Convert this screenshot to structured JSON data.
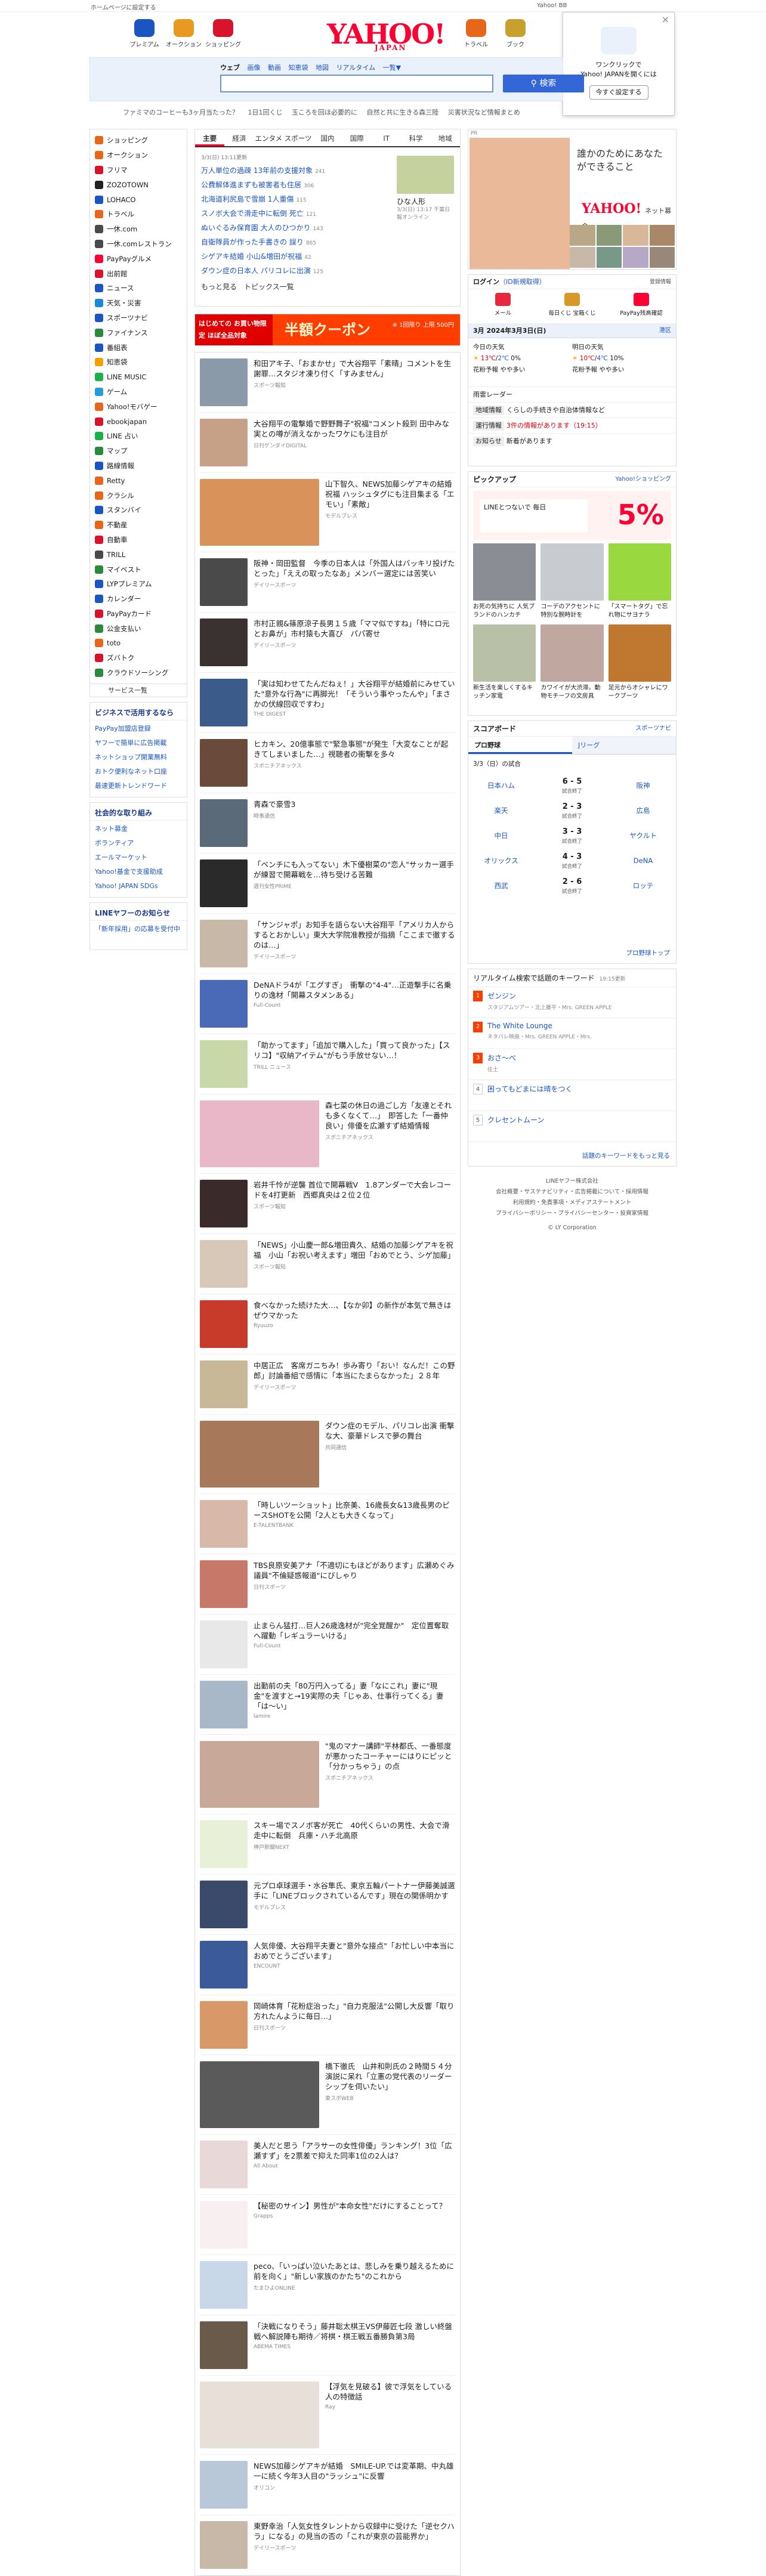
{
  "topbar": {
    "home": "ホームページに設定する",
    "right": "Yahoo! BB"
  },
  "header": {
    "logo": "YAHOO!",
    "logo_sub": "JAPAN",
    "services": [
      "プレミアム",
      "オークション",
      "ショッピング",
      "トラベル",
      "ブック"
    ]
  },
  "popup": {
    "line1": "ワンクリックで",
    "line2": "Yahoo! JAPANを開くには",
    "button": "今すぐ設定する",
    "close": "×"
  },
  "search": {
    "tabs": [
      "ウェブ",
      "画像",
      "動画",
      "知恵袋",
      "地図",
      "リアルタイム",
      "一覧▼"
    ],
    "placeholder": "",
    "button": "検索"
  },
  "notices": [
    "ファミマのコーヒーも3ヶ月当たった？",
    "1日1回くじ",
    "玉ころを回ほ必要的に",
    "自然と共に生きる森三陸",
    "災害状況など情報まとめ"
  ],
  "leftnav": {
    "items": [
      "ショッピング",
      "オークション",
      "フリマ",
      "ZOZOTOWN",
      "LOHACO",
      "トラベル",
      "一休.com",
      "一休.comレストラン",
      "PayPayグルメ",
      "出前館",
      "ニュース",
      "天気・災害",
      "スポーツナビ",
      "ファイナンス",
      "番組表",
      "知恵袋",
      "LINE MUSIC",
      "ゲーム",
      "Yahoo!モバゲー",
      "ebookjapan",
      "LINE 占い",
      "マップ",
      "路線情報",
      "Retty",
      "クラシル",
      "スタンバイ",
      "不動産",
      "自動車",
      "TRILL",
      "マイベスト",
      "LYPプレミアム",
      "カレンダー",
      "PayPayカード",
      "公金支払い",
      "toto",
      "ズバトク",
      "クラウドソーシング"
    ],
    "all": "サービス一覧",
    "biz_title": "ビジネスで活用するなら",
    "biz": [
      "PayPay加盟店登録",
      "ヤフーで簡単に広告掲載",
      "ネットショップ開業無料",
      "おトク便利なネット口座",
      "最速更新トレンドワード"
    ],
    "social_title": "社会的な取り組み",
    "social": [
      "ネット募金",
      "ボランティア",
      "エールマーケット",
      "Yahoo!基金で支援助成",
      "Yahoo! JAPAN SDGs"
    ],
    "line_title": "LINEヤフーのお知らせ",
    "line_text": "「新年採用」の応募を受付中"
  },
  "topics": {
    "tabs": [
      "主要",
      "経済",
      "エンタメ",
      "スポーツ",
      "国内",
      "国際",
      "IT",
      "科学",
      "地域"
    ],
    "timestamp": "3/3(日) 13:11更新",
    "items": [
      {
        "t": "万人単位の過疎 13年前の支援対象",
        "c": "241"
      },
      {
        "t": "公費解体進まずも被害者も住居",
        "c": "306"
      },
      {
        "t": "北海道利尻島で雪崩 1人重傷",
        "c": "115"
      },
      {
        "t": "スノボ大会で滑走中に転倒 死亡",
        "c": "121"
      },
      {
        "t": "ぬいぐるみ保育園 大人のひつかり",
        "c": "143"
      },
      {
        "t": "自衛隊員が作った手書きの 誤り",
        "c": "865"
      },
      {
        "t": "シゲアキ結婚 小山&増田が祝福",
        "c": "42"
      },
      {
        "t": "ダウン症の日本人 パリコレに出演",
        "c": "125"
      }
    ],
    "more": "もっと見る　トピックス一覧",
    "pic_caption": "ひな人形",
    "pic_sub": "3/3(日) 13:17 千葉日報オンライン"
  },
  "banner": {
    "left": "はじめての お買い物限定 ほぼ全品対象",
    "mid": "半額クーポン",
    "right": "※ 1回限り 上限 500円"
  },
  "feed": [
    {
      "t": "和田アキ子、「おまかせ」で大谷翔平「素晴」コメントを生謝罪…スタジオ凍り付く「すみません」",
      "s": "スポーツ報知",
      "c": "#8a9aa8"
    },
    {
      "t": "大谷翔平の電撃婚で野野舞子\"祝福\"コメント殺到 田中みな実との噂が消えなかったワケにも注目が",
      "s": "日刊ゲンダイDIGITAL",
      "c": "#c7a088"
    },
    {
      "t": "山下智久、NEWS加藤シゲアキの結婚祝福 ハッシュタグにも注目集まる「エモい」「素敵」",
      "s": "モデルプレス",
      "c": "#d9935a",
      "w": true
    },
    {
      "t": "阪神・岡田監督　今季の日本人は「外国人はバッキリ投げたとった」「ええの取ったなあ」メンバー選定には苦笑い",
      "s": "デイリースポーツ",
      "c": "#4a4a4a"
    },
    {
      "t": "市村正親&篠原涼子長男１５歳「ママ似ですね」「特にロ元とお鼻が」市村猿も大喜び　パパ寄せ",
      "s": "デイリースポーツ",
      "c": "#3a3230"
    },
    {
      "t": "「実は知わせてたんだねぇ！」大谷翔平が結婚前にみせていた\"意外な行為\"に再脚光！「そういう事やったんや」「まさかの伏線回収ですわ」",
      "s": "THE DIGEST",
      "c": "#3b5b8a"
    },
    {
      "t": "ヒカキン、20億事態で\"緊急事態\"が発生「大変なことが起きてしまいました…」視聴者の衝撃を多々",
      "s": "スポニチアネックス",
      "c": "#6a4a3a"
    },
    {
      "t": "青森で豪雪3",
      "s": "時事通信",
      "c": "#5a6a78"
    },
    {
      "t": "「ベンチにも入ってない」木下優樹菜の\"恋人\"サッカー選手が練習で開幕戦を…待ち受ける苦難",
      "s": "週刊女性PRIME",
      "c": "#2a2a2a"
    },
    {
      "t": "「サンジャポ」お知手を語らない大谷翔平「アメリカ人からするとおかしい」東大大学院准教授が指摘「ここまで徹するのは…」",
      "s": "デイリースポーツ",
      "c": "#c8b8a8"
    },
    {
      "t": "DeNAドラ4が「エグすぎ」　衝撃の\"4-4\"…正遊撃手に名乗りの逸材「開幕スタメンある」",
      "s": "Full-Count",
      "c": "#4a6ab8"
    },
    {
      "t": "「助かってます」「追加で購入した」「買って良かった」【スリコ】\"収納アイテム\"がもう手放せない…！",
      "s": "TRILL ニュース",
      "c": "#c8d8a8"
    },
    {
      "t": "森七菜の休日の過ごし方「友達とそれも多くなくて…」　即答した「一番仲良い」俳優を広瀬すず結婚情報",
      "s": "スポニチアネックス",
      "c": "#e8b8c8",
      "w": true
    },
    {
      "t": "岩井千怜が逆襲 首位で開幕戦V　1.8アンダーで大会レコードを4打更新　西郷真央は２位２位",
      "s": "スポーツ報知",
      "c": "#3a2a2a"
    },
    {
      "t": "「NEWS」小山慶一郎&増田貴久、結婚の加藤シゲアキを祝福　小山「お祝い考えます」増田「おめでとう、シゲ加藤」",
      "s": "スポーツ報知",
      "c": "#d8c8b8"
    },
    {
      "t": "食べなかった続けた大…、【なか卯】の新作が本気で無きはぜウマかった",
      "s": "Ryuuzo",
      "c": "#c83a2a"
    },
    {
      "t": "中居正広　客席ガニちみ！歩み寄り「おい！なんだ！この野郎」討論番組で感情に「本当にたまらなかった」２８年",
      "s": "デイリースポーツ",
      "c": "#c8b898"
    },
    {
      "t": "ダウン症のモデル、パリコレ出演 衝撃な大、豪華ドレスで夢の舞台",
      "s": "共同通信",
      "c": "#a8785a",
      "w": true
    },
    {
      "t": "「時しいツーショット」比奈美、16歳長女&13歳長男のピースSHOTを公開「2人とも大きくなって」",
      "s": "E-TALENTBANK",
      "c": "#d8b8a8"
    },
    {
      "t": "TBS良原安美アナ「不適切にもほどがあります」広瀬めぐみ議員\"不倫疑惑報道\"にびしゃり",
      "s": "日刊スポーツ",
      "c": "#c87868"
    },
    {
      "t": "止まらん猛打…巨人26歳逸材が\"完全覚醒か\"　定位置奪取へ躍動「レギュラーいける」",
      "s": "Full-Count",
      "c": "#e8e8e8"
    },
    {
      "t": "出勤前の夫「80万円入ってる」妻「なにこれ」妻に\"現金\"を渡すと→19実際の夫「じゃあ、仕事行ってくる」妻「は〜い」",
      "s": "lamire",
      "c": "#a8b8c8"
    },
    {
      "t": "\"鬼のマナー講師\"平林都氏、一番態度が悪かったコーチャーにはりにピッと「分かっちゃう」の点",
      "s": "スポニチアネックス",
      "c": "#c8a898",
      "w": true
    },
    {
      "t": "スキー場でスノボ客が死亡　40代くらいの男性、大会で滑走中に転倒　兵庫・ハチ北高原",
      "s": "神戸新聞NEXT",
      "c": "#e8f0d8"
    },
    {
      "t": "元プロ卓球選手・水谷隼氏、東京五輪パートナー伊藤美誠選手に「LINEブロックされているんです」現在の関係明かす",
      "s": "モデルプレス",
      "c": "#3a4a6a"
    },
    {
      "t": "人気俳優、大谷翔平夫妻と\"意外な接点\"「お忙しい中本当におめでとうございます」",
      "s": "ENCOUNT",
      "c": "#3a5a9a"
    },
    {
      "t": "岡崎体育「花粉症治った」\"自力克服法\"公開し大反響「取り方れたんように毎日…」",
      "s": "日刊スポーツ",
      "c": "#d89868"
    },
    {
      "t": "橋下徹氏　山井和則氏の２時間５４分演説に呆れ「立憲の党代表のリーダーシップを伺いたい」",
      "s": "東スポWEB",
      "c": "#5a5a5a",
      "w": true
    },
    {
      "t": "美人だと思う「アラサーの女性俳優」ランキング！3位「広瀬すず」を2票差で抑えた同率1位の2人は？",
      "s": "All About",
      "c": "#e8d8d8"
    },
    {
      "t": "【秘密のサイン】男性が\"本命女性\"だけにすることって？",
      "s": "Grapps",
      "c": "#f8f0f0"
    },
    {
      "t": "peco、「いっぱい泣いたあとは、悲しみを乗り越えるために前を向く」\"新しい家族のかたち\"のこれから",
      "s": "たまひよONLINE",
      "c": "#c8d8e8"
    },
    {
      "t": "「決戦になりそう」藤井聡太棋王VS伊藤匠七段 激しい終盤戦へ解説陣も期待／将棋・棋王戦五番勝負第3局",
      "s": "ABEMA TIMES",
      "c": "#6a5a4a"
    },
    {
      "t": "【浮気を見破る】彼で浮気をしている人の特徴話",
      "s": "Ray",
      "c": "#e8e0d8",
      "w": true
    },
    {
      "t": "NEWS加藤シゲアキが結婚　SMILE-UP.では変革期、中丸雄一に続く今年3人目の\"ラッシュ\"に反響",
      "s": "オリコン",
      "c": "#b8c8d8"
    },
    {
      "t": "東野幸治「人気女性タレントから収録中に受けた「逆セクハラ」になる」の見当の否の「これが東京の芸能界か」",
      "s": "デイリースポーツ",
      "c": "#c8b8a8"
    }
  ],
  "photo": {
    "label": "PR",
    "copy1": "誰かのためにあなたができること",
    "logo": "YAHOO!",
    "logo_sub": "ネット募金"
  },
  "login": {
    "title": "ログイン",
    "extra": "ID新規取得",
    "reg": "登録情報",
    "icons": [
      "メール",
      "毎日くじ 宝箱くじ",
      "PayPay残高確認"
    ],
    "date": "3月 2024年3月3日(日)",
    "place": "港区",
    "today": "今日の天気",
    "tomorrow": "明日の天気",
    "t_hi": "13℃",
    "t_lo": "2℃",
    "t_rain": "0%",
    "m_hi": "10℃",
    "m_lo": "4℃",
    "m_rain": "10%",
    "pollen": "花粉予報",
    "pollen_v": "やや多い",
    "wave": "雨雲レーダー",
    "area": "地域情報",
    "area_v": "くらしの手続きや自治体情報など",
    "train": "運行情報",
    "train_v": "3件の情報があります（19:15）",
    "notice": "お知らせ",
    "notice_v": "新着があります"
  },
  "pickup": {
    "title": "ピックアップ",
    "sub": "Yahoo!ショッピング",
    "ban_text": "LINEとつないで 毎日",
    "ban_pct": "5%",
    "items": [
      {
        "t": "お死の気持ちに 人気ブランドのハンカチ",
        "c": "#8a8e94"
      },
      {
        "t": "コーデのアクセントに 特別な腕時計を",
        "c": "#c8ccd0"
      },
      {
        "t": "「スマートタグ」で忘れ物にサヨナラ",
        "c": "#9ad840"
      },
      {
        "t": "新生活を楽しくするキッチン家電",
        "c": "#b8c0a8"
      },
      {
        "t": "カワイイが大渋滞。動物モチーフの文房具",
        "c": "#c0a8a0"
      },
      {
        "t": "足元からオシャレにワークブーツ",
        "c": "#c07830"
      }
    ]
  },
  "score": {
    "title": "スコアボード",
    "sub": "スポーツナビ",
    "tabs": [
      "プロ野球",
      "Jリーグ"
    ],
    "date": "3/3（日）の試合",
    "games": [
      {
        "h": "日本ハム",
        "s": "6 - 5",
        "st": "試合終了",
        "a": "阪神"
      },
      {
        "h": "楽天",
        "s": "2 - 3",
        "st": "試合終了",
        "a": "広島"
      },
      {
        "h": "中日",
        "s": "3 - 3",
        "st": "試合終了",
        "a": "ヤクルト"
      },
      {
        "h": "オリックス",
        "s": "4 - 3",
        "st": "試合終了",
        "a": "DeNA"
      },
      {
        "h": "西武",
        "s": "2 - 6",
        "st": "試合終了",
        "a": "ロッテ"
      }
    ],
    "footer": "プロ野球トップ"
  },
  "rank": {
    "title": "リアルタイム検索で話題のキーワード",
    "time": "19:15更新",
    "items": [
      {
        "n": "1",
        "k": "ゼンジン",
        "s": "スタジアムツアー・北上藤平・Mrs. GREEN APPLE"
      },
      {
        "n": "2",
        "k": "The White Lounge",
        "s": "ネタバレ映画・Mrs. GREEN APPLE・Mrs."
      },
      {
        "n": "3",
        "k": "おさ〜べ",
        "s": "住土"
      },
      {
        "n": "4",
        "k": "困ってもどまには晴をつく",
        "s": ""
      },
      {
        "n": "5",
        "k": "クレセントムーン",
        "s": ""
      }
    ],
    "footer": "話題のキーワードをもっと見る"
  },
  "footer": {
    "company": "LINEヤフー株式会社",
    "links": "会社概要・サステナビリティ・広告掲載について・採用情報",
    "links2": "利用規約・免責事項・メディアステートメント",
    "links3": "プライバシーポリシー・プライバシーセンター・投資家情報",
    "copy": "© LY Corporation"
  }
}
